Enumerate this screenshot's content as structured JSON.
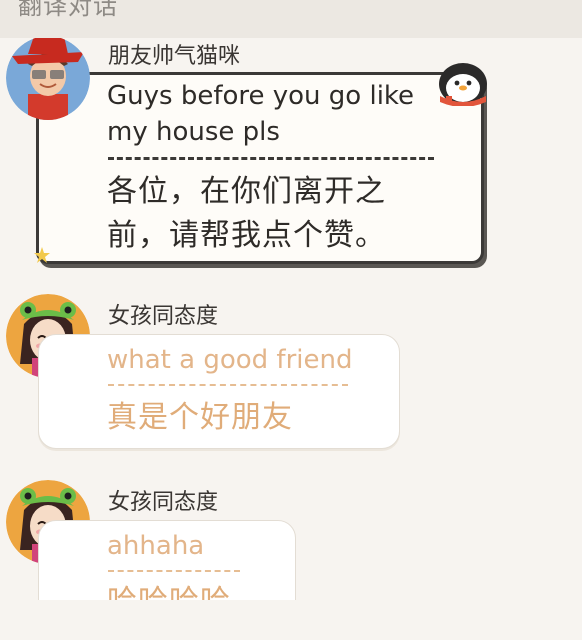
{
  "header": {
    "title": "翻译对话"
  },
  "messages": [
    {
      "sender": "朋友帅气猫咪",
      "original": "Guys before you go like my house pls",
      "original_lines": [
        "Guys before you go like",
        "my house pls"
      ],
      "translation_lines": [
        "各位，在你们离开之",
        "前，请帮我点个赞。"
      ],
      "style": "special"
    },
    {
      "sender": "女孩同态度",
      "original": "what a good friend",
      "translation": "真是个好朋友",
      "style": "plain"
    },
    {
      "sender": "女孩同态度",
      "original": "ahhaha",
      "translation": "哈哈哈哈",
      "style": "plain"
    }
  ],
  "colors": {
    "background": "#f7f4f0",
    "header_bg": "#ece8e2",
    "accent_orange": "#e3b58a",
    "dark_border": "#3b3937"
  }
}
